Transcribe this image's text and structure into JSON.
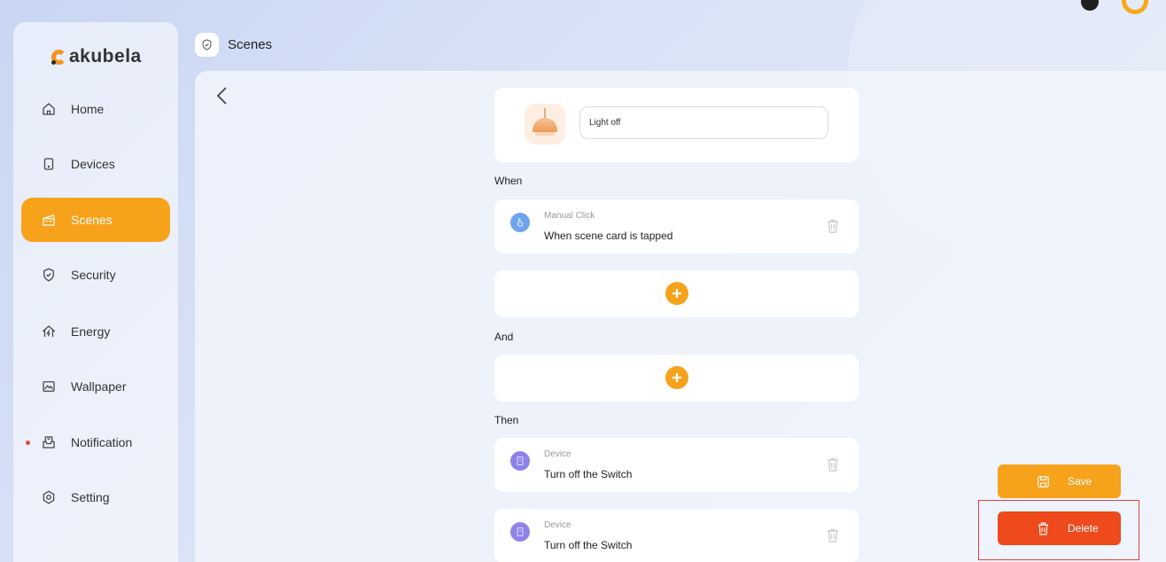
{
  "app": {
    "logo_text": "akubela"
  },
  "colors": {
    "accent": "#f7a21b",
    "delete": "#ee4a1c",
    "highlight": "#e0423c"
  },
  "sidebar": {
    "items": [
      {
        "label": "Home",
        "icon": "home-icon"
      },
      {
        "label": "Devices",
        "icon": "device-icon"
      },
      {
        "label": "Scenes",
        "icon": "scenes-icon",
        "active": true
      },
      {
        "label": "Security",
        "icon": "shield-icon"
      },
      {
        "label": "Energy",
        "icon": "energy-icon"
      },
      {
        "label": "Wallpaper",
        "icon": "wallpaper-icon"
      },
      {
        "label": "Notification",
        "icon": "notification-icon",
        "has_dot": true
      },
      {
        "label": "Setting",
        "icon": "gear-icon"
      }
    ]
  },
  "header": {
    "title": "Scenes",
    "icon": "shield-icon"
  },
  "scene": {
    "name_value": "Light off",
    "icon": "lamp-icon"
  },
  "sections": {
    "when": "When",
    "and": "And",
    "then": "Then"
  },
  "when_items": [
    {
      "sub": "Manual Click",
      "main": "When scene card is tapped",
      "icon": "tap-icon"
    }
  ],
  "then_items": [
    {
      "sub": "Device",
      "main": "Turn off the Switch",
      "icon": "switch-device-icon"
    },
    {
      "sub": "Device",
      "main": "Turn off the Switch",
      "icon": "switch-device-icon"
    }
  ],
  "actions": {
    "save_label": "Save",
    "delete_label": "Delete"
  }
}
